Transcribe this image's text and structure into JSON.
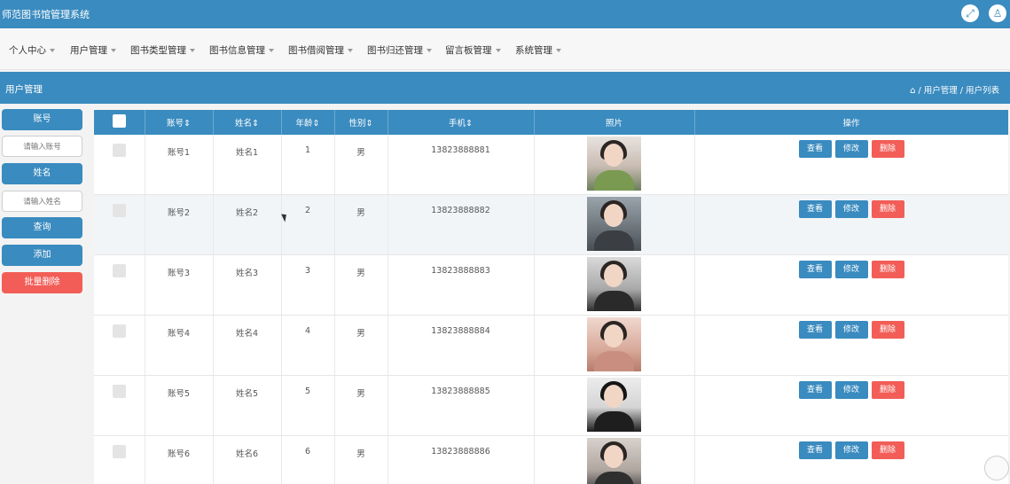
{
  "app": {
    "title": "师范图书馆管理系统"
  },
  "topbar": {
    "fullscreen_icon": "expand-icon",
    "user_icon": "user-icon"
  },
  "nav": {
    "items": [
      {
        "label": "个人中心"
      },
      {
        "label": "用户管理"
      },
      {
        "label": "图书类型管理"
      },
      {
        "label": "图书信息管理"
      },
      {
        "label": "图书借阅管理"
      },
      {
        "label": "图书归还管理"
      },
      {
        "label": "留言板管理"
      },
      {
        "label": "系统管理"
      }
    ]
  },
  "page": {
    "title": "用户管理",
    "breadcrumb": "/ 用户管理 / 用户列表"
  },
  "search": {
    "account_label": "账号",
    "account_placeholder": "请输入账号",
    "name_label": "姓名",
    "name_placeholder": "请输入姓名",
    "query_button": "查询",
    "add_button": "添加",
    "batch_delete_button": "批量删除"
  },
  "table": {
    "headers": [
      "账号",
      "姓名",
      "年龄",
      "性别",
      "手机",
      "照片",
      "操作"
    ],
    "sortable_headers": [
      "账号",
      "姓名",
      "年龄",
      "性别",
      "手机"
    ],
    "rows": [
      {
        "account": "账号1",
        "name": "姓名1",
        "age": "1",
        "gender": "男",
        "phone": "13823888881"
      },
      {
        "account": "账号2",
        "name": "姓名2",
        "age": "2",
        "gender": "男",
        "phone": "13823888882"
      },
      {
        "account": "账号3",
        "name": "姓名3",
        "age": "3",
        "gender": "男",
        "phone": "13823888883"
      },
      {
        "account": "账号4",
        "name": "姓名4",
        "age": "4",
        "gender": "男",
        "phone": "13823888884"
      },
      {
        "account": "账号5",
        "name": "姓名5",
        "age": "5",
        "gender": "男",
        "phone": "13823888885"
      },
      {
        "account": "账号6",
        "name": "姓名6",
        "age": "6",
        "gender": "男",
        "phone": "13823888886"
      }
    ],
    "actions": {
      "view": "查看",
      "edit": "修改",
      "delete": "删除"
    }
  },
  "colors": {
    "primary": "#3a8bbf",
    "danger": "#f25e57"
  }
}
